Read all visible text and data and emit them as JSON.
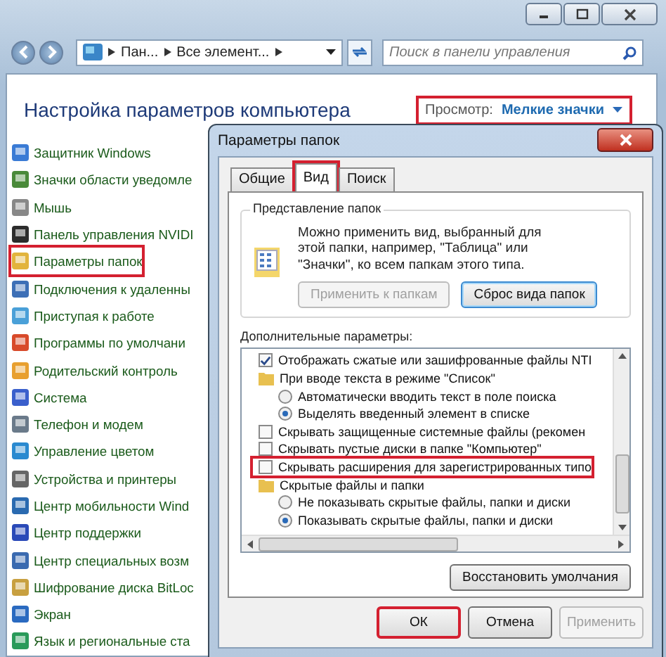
{
  "window": {
    "breadcrumb": [
      "Пан...",
      "Все элемент..."
    ],
    "search": {
      "placeholder": "Поиск в панели управления"
    }
  },
  "heading": "Настройка параметров компьютера",
  "view": {
    "label": "Просмотр:",
    "value": "Мелкие значки",
    "highlighted": true
  },
  "items": [
    {
      "label": "Защитник Windows",
      "highlighted": false
    },
    {
      "label": "Значки области уведомле",
      "highlighted": false
    },
    {
      "label": "Мышь",
      "highlighted": false
    },
    {
      "label": "Панель управления NVIDI",
      "highlighted": false
    },
    {
      "label": "Параметры папок",
      "highlighted": true
    },
    {
      "label": "Подключения к удаленны",
      "highlighted": false
    },
    {
      "label": "Приступая к работе",
      "highlighted": false
    },
    {
      "label": "Программы по умолчани",
      "highlighted": false
    },
    {
      "label": "Родительский контроль",
      "highlighted": false
    },
    {
      "label": "Система",
      "highlighted": false
    },
    {
      "label": "Телефон и модем",
      "highlighted": false
    },
    {
      "label": "Управление цветом",
      "highlighted": false
    },
    {
      "label": "Устройства и принтеры",
      "highlighted": false
    },
    {
      "label": "Центр мобильности Wind",
      "highlighted": false
    },
    {
      "label": "Центр поддержки",
      "highlighted": false
    },
    {
      "label": "Центр специальных возм",
      "highlighted": false
    },
    {
      "label": "Шифрование диска BitLoc",
      "highlighted": false
    },
    {
      "label": "Экран",
      "highlighted": false
    },
    {
      "label": "Язык и региональные ста",
      "highlighted": false
    }
  ],
  "dialog": {
    "title": "Параметры папок",
    "tabs": [
      {
        "label": "Общие",
        "selected": false,
        "highlighted": false
      },
      {
        "label": "Вид",
        "selected": true,
        "highlighted": true
      },
      {
        "label": "Поиск",
        "selected": false,
        "highlighted": false
      }
    ],
    "group": {
      "title": "Представление папок",
      "text": "Можно применить вид, выбранный для этой папки, например, \"Таблица\" или \"Значки\", ко всем папкам этого типа.",
      "buttons": [
        {
          "label": "Применить к папкам",
          "disabled": true
        },
        {
          "label": "Сброс вида папок",
          "disabled": false
        }
      ]
    },
    "advanced_label": "Дополнительные параметры:",
    "options": [
      {
        "kind": "checkbox",
        "label": "Отображать сжатые или зашифрованные файлы NTI",
        "checked": true,
        "highlighted": false
      },
      {
        "kind": "folder",
        "label": "При вводе текста в режиме \"Список\"",
        "highlighted": false,
        "children": [
          {
            "kind": "radio",
            "label": "Автоматически вводить текст в поле поиска",
            "selected": false
          },
          {
            "kind": "radio",
            "label": "Выделять введенный элемент в списке",
            "selected": true
          }
        ]
      },
      {
        "kind": "checkbox",
        "label": "Скрывать защищенные системные файлы (рекомен",
        "checked": false,
        "highlighted": false
      },
      {
        "kind": "checkbox",
        "label": "Скрывать пустые диски в папке \"Компьютер\"",
        "checked": false,
        "highlighted": false
      },
      {
        "kind": "checkbox",
        "label": "Скрывать расширения для зарегистрированных типо",
        "checked": false,
        "highlighted": true
      },
      {
        "kind": "folder",
        "label": "Скрытые файлы и папки",
        "highlighted": false,
        "children": [
          {
            "kind": "radio",
            "label": "Не показывать скрытые файлы, папки и диски",
            "selected": false
          },
          {
            "kind": "radio",
            "label": "Показывать скрытые файлы, папки и диски",
            "selected": true
          }
        ]
      }
    ],
    "restore": "Восстановить умолчания",
    "buttons": [
      {
        "label": "ОК",
        "disabled": false,
        "highlighted": true
      },
      {
        "label": "Отмена",
        "disabled": false,
        "highlighted": false
      },
      {
        "label": "Применить",
        "disabled": true,
        "highlighted": false
      }
    ]
  }
}
